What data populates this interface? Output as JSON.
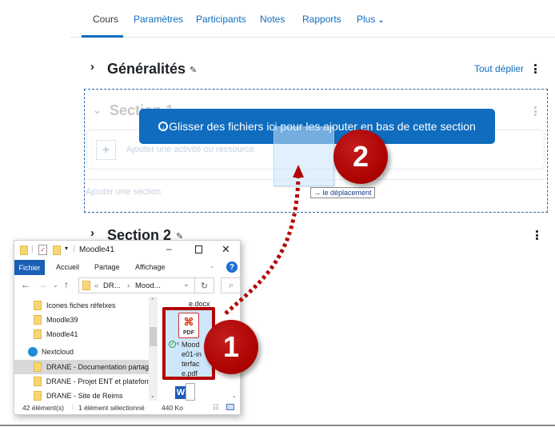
{
  "nav": {
    "tabs": [
      {
        "label": "Cours",
        "active": true
      },
      {
        "label": "Paramètres",
        "active": false
      },
      {
        "label": "Participants",
        "active": false
      },
      {
        "label": "Notes",
        "active": false
      },
      {
        "label": "Rapports",
        "active": false
      },
      {
        "label": "Plus",
        "active": false
      }
    ],
    "more_chevron": "⌄"
  },
  "course": {
    "generalites_title": "Généralités",
    "expand_all": "Tout déplier",
    "section1_title": "Section 1",
    "add_activity": "Ajouter une activité ou ressource",
    "add_section": "Ajouter une section",
    "section2_title": "Section 2"
  },
  "drag": {
    "banner_text": "Glisser des fichiers ici pour les ajouter en bas de cette section",
    "tooltip": "le déplacement",
    "tooltip_arrow": "→"
  },
  "annotations": {
    "step1": "1",
    "step2": "2",
    "arrow_color": "#b30000"
  },
  "explorer": {
    "title": "Moodle41",
    "ribbon": {
      "file": "Fichier",
      "home": "Accueil",
      "share": "Partage",
      "view": "Affichage"
    },
    "address": {
      "part1": "DR...",
      "part2": "Mood..."
    },
    "tree": [
      {
        "label": "Icones fiches réfelxes",
        "type": "folder",
        "selected": false
      },
      {
        "label": "Moodle39",
        "type": "folder",
        "selected": false
      },
      {
        "label": "Moodle41",
        "type": "folder",
        "selected": false
      },
      {
        "label": "Nextcloud",
        "type": "cloud",
        "selected": false
      },
      {
        "label": "DRANE - Documentation partag",
        "type": "folder",
        "selected": true
      },
      {
        "label": "DRANE - Projet ENT et plateform",
        "type": "folder",
        "selected": false
      },
      {
        "label": "DRANE - Site de Reims",
        "type": "folder",
        "selected": false
      }
    ],
    "files": {
      "above_name": "e.docx",
      "selected_file": {
        "icon_label": "PDF",
        "name_lines": [
          "Mood",
          "e01-in",
          "terfac",
          "e.pdf"
        ]
      }
    },
    "status": {
      "count": "42 élément(s)",
      "selection": "1 élément sélectionné",
      "size": "440 Ko"
    }
  },
  "colors": {
    "accent": "#0f6cbf",
    "annotation_red": "#b30000"
  }
}
